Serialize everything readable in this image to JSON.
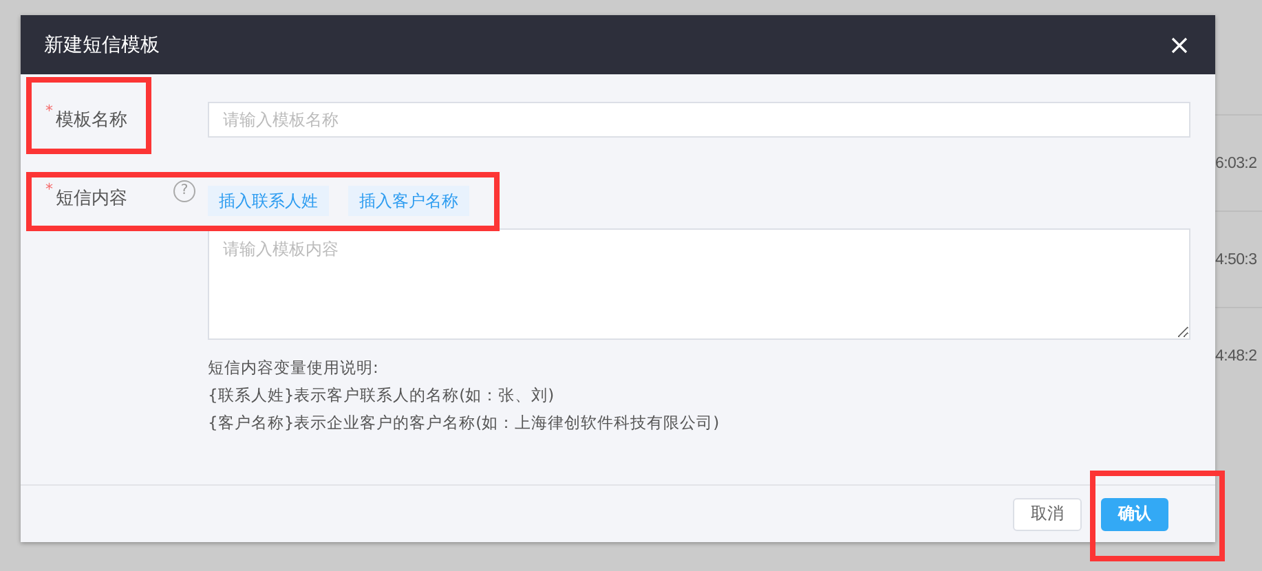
{
  "background_table": {
    "times": [
      "6:03:2",
      "4:50:3",
      "4:48:2"
    ]
  },
  "dialog": {
    "title": "新建短信模板",
    "fields": [
      {
        "kind": "input",
        "label": "模板名称",
        "required_mark": "*",
        "placeholder": "请输入模板名称",
        "highlighted": true
      },
      {
        "kind": "textarea",
        "label": "短信内容",
        "required_mark": "*",
        "hint_mark": "?",
        "placeholder": "请输入模板内容",
        "highlighted": true,
        "insert_buttons": [
          "插入联系人姓",
          "插入客户名称"
        ],
        "help_lines": [
          "短信内容变量使用说明:",
          "{联系人姓}表示客户联系人的名称(如：张、刘)",
          "{客户名称}表示企业客户的客户名称(如：上海律创软件科技有限公司)"
        ]
      }
    ],
    "buttons": [
      {
        "label": "取消",
        "primary": false,
        "highlighted": false
      },
      {
        "label": "确认",
        "primary": true,
        "highlighted": true
      }
    ]
  }
}
